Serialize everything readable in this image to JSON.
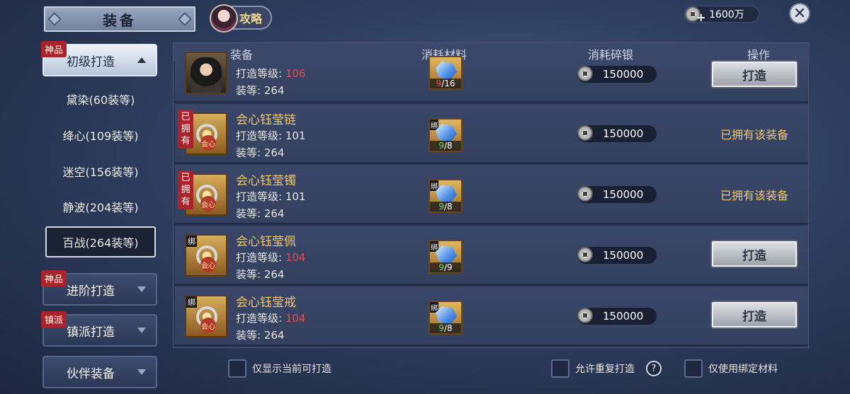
{
  "header": {
    "title": "装备",
    "guide_label": "攻略",
    "currency_amount": "1600万",
    "currency_plus": "+",
    "close_symbol": "✕"
  },
  "sidebar": {
    "categories": [
      {
        "label": "初级打造",
        "tag": "神品",
        "expanded": true
      },
      {
        "label": "进阶打造",
        "tag": "神品",
        "expanded": false
      },
      {
        "label": "镇派打造",
        "tag": "镇派",
        "expanded": false
      },
      {
        "label": "伙伴装备",
        "tag": "",
        "expanded": false
      }
    ],
    "sub_items": [
      {
        "label": "黛染(60装等)",
        "selected": false
      },
      {
        "label": "绛心(109装等)",
        "selected": false
      },
      {
        "label": "迷空(156装等)",
        "selected": false
      },
      {
        "label": "静波(204装等)",
        "selected": false
      },
      {
        "label": "百战(264装等)",
        "selected": true
      }
    ]
  },
  "table": {
    "headers": [
      "装备",
      "消耗材料",
      "消耗碎银",
      "操作"
    ],
    "bind_label": "绑",
    "owned_tag": "已拥有",
    "ornate_label": "会心",
    "rows": [
      {
        "name": "",
        "forge_label": "打造等级: ",
        "forge_level": "106",
        "forge_level_short": true,
        "gear_label": "装等: ",
        "gear_level": "264",
        "mat_have": "9",
        "mat_need": "/16",
        "mat_short": true,
        "cost": "150000",
        "action": "打造",
        "owned": false
      },
      {
        "name": "会心钰莹链",
        "forge_label": "打造等级: ",
        "forge_level": "101",
        "forge_level_short": false,
        "gear_label": "装等: ",
        "gear_level": "264",
        "mat_have": "9",
        "mat_need": "/8",
        "mat_short": false,
        "cost": "150000",
        "action": "已拥有该装备",
        "owned": true
      },
      {
        "name": "会心钰莹镯",
        "forge_label": "打造等级: ",
        "forge_level": "101",
        "forge_level_short": false,
        "gear_label": "装等: ",
        "gear_level": "264",
        "mat_have": "9",
        "mat_need": "/8",
        "mat_short": false,
        "cost": "150000",
        "action": "已拥有该装备",
        "owned": true
      },
      {
        "name": "会心钰莹佩",
        "forge_label": "打造等级: ",
        "forge_level": "104",
        "forge_level_short": true,
        "gear_label": "装等: ",
        "gear_level": "264",
        "mat_have": "9",
        "mat_need": "/9",
        "mat_short": false,
        "cost": "150000",
        "action": "打造",
        "owned": false
      },
      {
        "name": "会心钰莹戒",
        "forge_label": "打造等级: ",
        "forge_level": "104",
        "forge_level_short": true,
        "gear_label": "装等: ",
        "gear_level": "264",
        "mat_have": "9",
        "mat_need": "/8",
        "mat_short": false,
        "cost": "150000",
        "action": "打造",
        "owned": false
      }
    ]
  },
  "footer": {
    "only_craftable": "仅显示当前可打造",
    "allow_repeat": "允许重复打造",
    "help_symbol": "?",
    "only_bound": "仅使用绑定材料"
  },
  "colors": {
    "accent_gold": "#f0c66a",
    "short_red": "#e64a4a",
    "ok_green": "#5fe06b"
  }
}
